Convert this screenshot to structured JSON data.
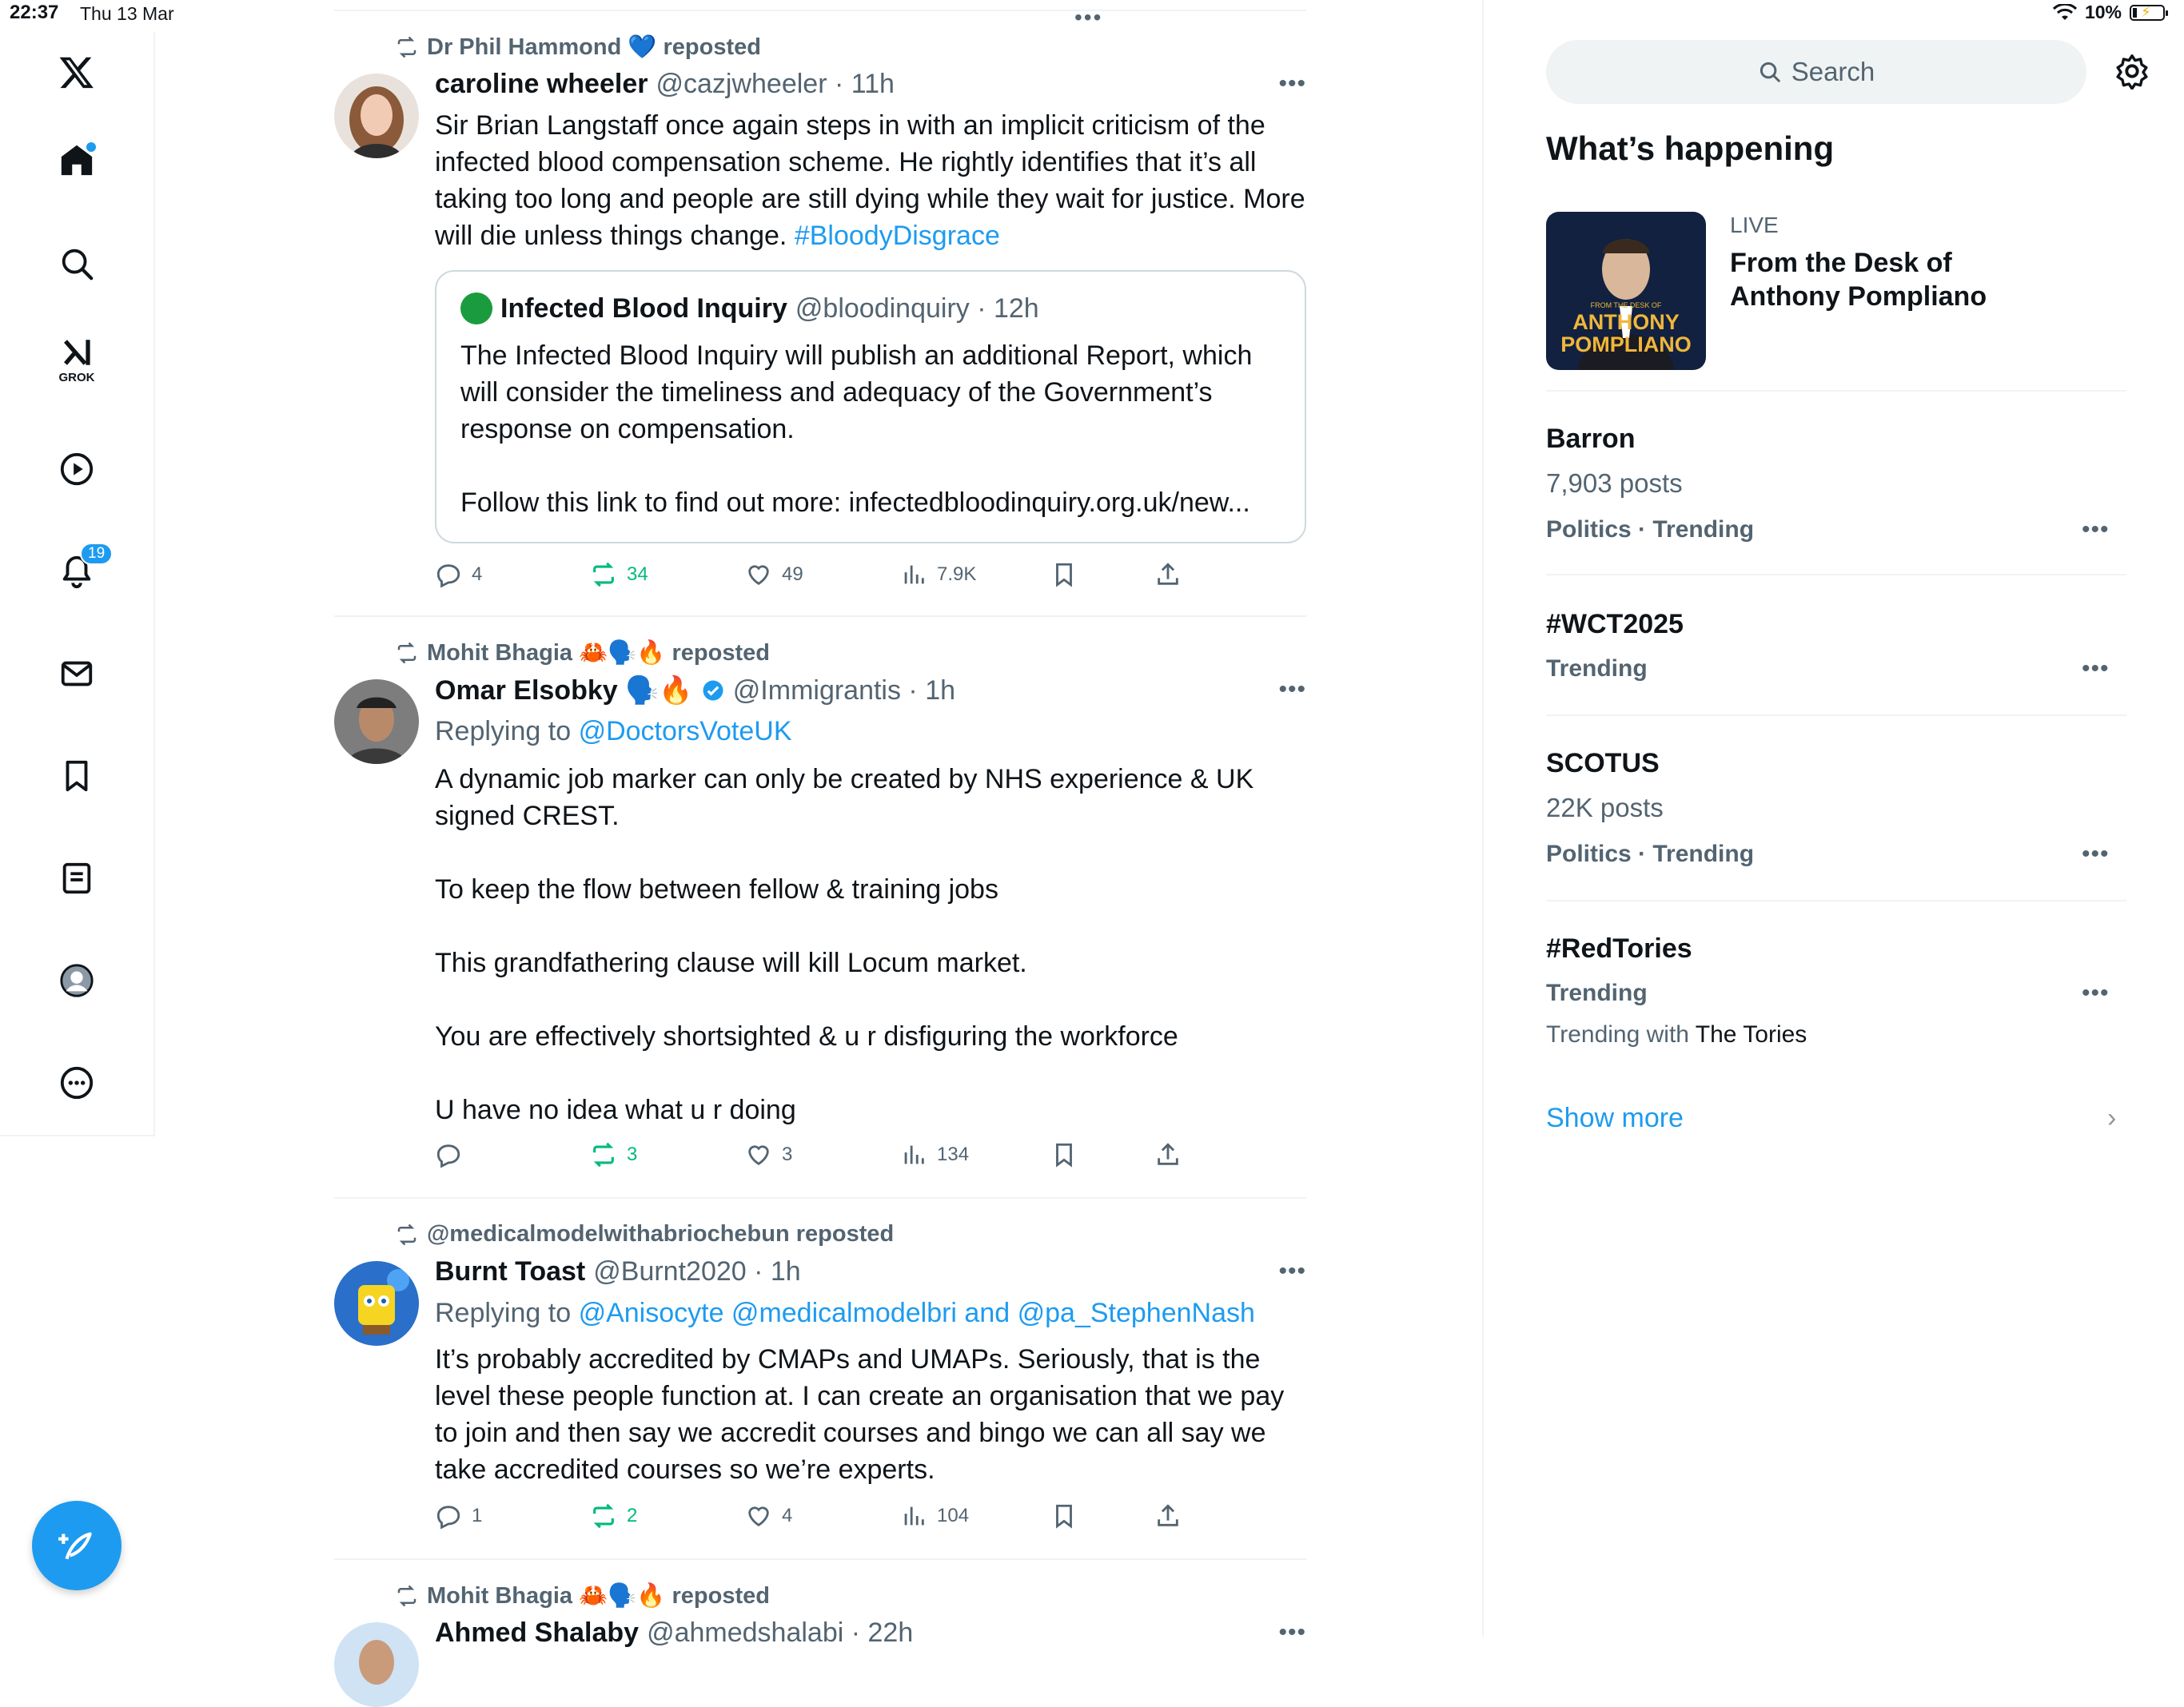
{
  "status_bar": {
    "time": "22:37",
    "date": "Thu 13 Mar",
    "battery": "10%",
    "battery_level": 0.1
  },
  "nav": {
    "items": [
      {
        "icon": "x-logo-icon"
      },
      {
        "icon": "home-icon"
      },
      {
        "icon": "search-icon"
      },
      {
        "icon": "grok-icon",
        "label": "GROK"
      },
      {
        "icon": "video-icon"
      },
      {
        "icon": "notifications-icon",
        "badge": "19"
      },
      {
        "icon": "messages-icon"
      },
      {
        "icon": "bookmarks-icon"
      },
      {
        "icon": "lists-icon"
      },
      {
        "icon": "profile-icon"
      },
      {
        "icon": "more-icon"
      }
    ],
    "compose_icon": "compose-icon"
  },
  "feed": {
    "posts": [
      {
        "repost_by": "Dr Phil Hammond 💙 reposted",
        "name": "caroline wheeler",
        "handle": "@cazjwheeler · 11h",
        "text": "Sir Brian Langstaff once again steps in with an implicit criticism of the infected blood compensation scheme. He rightly identifies that it’s all taking too long and people are still dying while they wait for justice. More will die unless things change.",
        "hashtag": "#BloodyDisgrace",
        "quote": {
          "name": "Infected Blood Inquiry",
          "handle": "@bloodinquiry · 12h",
          "text": "The Infected Blood Inquiry will publish an additional Report, which will consider the timeliness and adequacy of the Government’s response on compensation.\n\nFollow this link to find out more: infectedbloodinquiry.org.uk/new..."
        },
        "stats": {
          "replies": "4",
          "reposts": "34",
          "likes": "49",
          "views": "7.9K"
        }
      },
      {
        "repost_by": "Mohit Bhagia 🦀🗣️🔥 reposted",
        "name": "Omar Elsobky 🗣️🔥",
        "handle": "@Immigrantis · 1h",
        "replying_prefix": "Replying to",
        "replying_to": "@DoctorsVoteUK",
        "text": "A dynamic job marker can only be created by NHS experience & UK signed CREST.\n\nTo keep the flow between fellow & training jobs\n\nThis grandfathering clause will kill Locum market.\n\nYou are effectively shortsighted & u r disfiguring the workforce\n\nU have no idea what u r doing",
        "stats": {
          "replies": "",
          "reposts": "3",
          "likes": "3",
          "views": "134"
        }
      },
      {
        "repost_by": "@medicalmodelwithabriochebun reposted",
        "name": "Burnt Toast",
        "handle": "@Burnt2020 · 1h",
        "replying_prefix": "Replying to",
        "replying_to": "@Anisocyte @medicalmodelbri and @pa_StephenNash",
        "text": "It’s probably accredited by CMAPs and UMAPs. Seriously, that is the level these people function at. I can create an organisation that we pay to join and then say we accredit courses and bingo we can all say we take accredited courses so we’re experts.",
        "stats": {
          "replies": "1",
          "reposts": "2",
          "likes": "4",
          "views": "104"
        }
      },
      {
        "repost_by": "Mohit Bhagia 🦀🗣️🔥 reposted",
        "name": "Ahmed Shalaby",
        "handle": "@ahmedshalabi · 22h"
      }
    ]
  },
  "sidebar": {
    "search_placeholder": "Search",
    "title": "What’s happening",
    "live": {
      "label": "LIVE",
      "title": "From the Desk of Anthony Pompliano",
      "thumb_caption_small": "FROM THE DESK OF",
      "thumb_caption": "ANTHONY POMPLIANO"
    },
    "trends": [
      {
        "name": "Barron",
        "posts": "7,903 posts",
        "meta": "Politics · Trending"
      },
      {
        "name": "#WCT2025",
        "meta": "Trending"
      },
      {
        "name": "SCOTUS",
        "posts": "22K posts",
        "meta": "Politics · Trending"
      },
      {
        "name": "#RedTories",
        "meta": "Trending",
        "with_prefix": "Trending with",
        "with_name": "The Tories"
      }
    ],
    "show_more": "Show more"
  },
  "colors": {
    "accent": "#1d9bf0",
    "repost_green": "#00ba7c",
    "text": "#0f1419",
    "muted": "#536471",
    "border": "#eff3f4"
  }
}
